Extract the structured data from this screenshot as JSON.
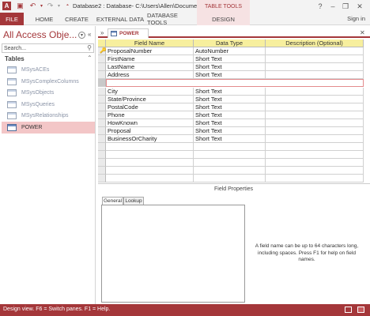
{
  "window": {
    "title": "Database2 : Database- C:\\Users\\Allen\\Document...",
    "contextual_group": "TABLE TOOLS",
    "help": "?",
    "controls": [
      "–",
      "❐",
      "✕"
    ]
  },
  "ribbon": {
    "tabs": [
      "FILE",
      "HOME",
      "CREATE",
      "EXTERNAL DATA",
      "DATABASE TOOLS",
      "DESIGN"
    ],
    "sign_in": "Sign in"
  },
  "nav": {
    "title": "All Access Obje...",
    "search_placeholder": "Search...",
    "group_label": "Tables",
    "items": [
      "MSysACEs",
      "MSysComplexColumns",
      "MSysObjects",
      "MSysQueries",
      "MSysRelationships",
      "POWER"
    ],
    "active_item": "POWER"
  },
  "document": {
    "tab_label": "POWER"
  },
  "design_grid": {
    "headers": [
      "Field Name",
      "Data Type",
      "Description (Optional)"
    ],
    "rows": [
      {
        "field": "ProposalNumber",
        "type": "AutoNumber",
        "primary_key": true
      },
      {
        "field": "FirstName",
        "type": "Short Text"
      },
      {
        "field": "LastName",
        "type": "Short Text"
      },
      {
        "field": "Address",
        "type": "Short Text"
      },
      {
        "field": "",
        "type": "",
        "selected": true
      },
      {
        "field": "City",
        "type": "Short Text"
      },
      {
        "field": "State/Province",
        "type": "Short Text"
      },
      {
        "field": "PostalCode",
        "type": "Short Text"
      },
      {
        "field": "Phone",
        "type": "Short Text"
      },
      {
        "field": "HowKnown",
        "type": "Short Text"
      },
      {
        "field": "Proposal",
        "type": "Short Text"
      },
      {
        "field": "BusinessOrCharity",
        "type": "Short Text"
      }
    ]
  },
  "field_properties": {
    "label": "Field Properties",
    "tabs": [
      "General",
      "Lookup"
    ],
    "help": "A field name can be up to 64 characters long, including spaces. Press F1 for help on field names."
  },
  "status_bar": {
    "text": "Design view.  F6 = Switch panes.  F1 = Help."
  },
  "colors": {
    "accent": "#a4373a",
    "header_fill": "#f7ef9e",
    "active_nav": "#f3c6c7",
    "selected_row_border": "#e38b8d"
  },
  "icons": {
    "save": "save-icon",
    "undo": "undo-icon",
    "redo": "redo-icon",
    "primary_key": "key-icon",
    "search": "search-icon",
    "table": "table-icon"
  }
}
